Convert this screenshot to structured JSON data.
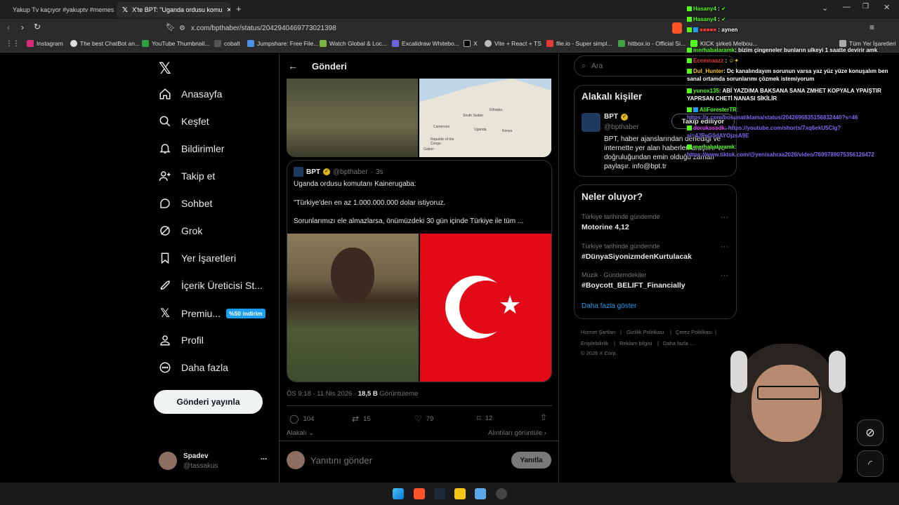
{
  "browser": {
    "tabs": [
      {
        "title": "Yakup Tv kaçıyor #yakuptv #memes",
        "active": false
      },
      {
        "title": "X'te BPT: \"Uganda ordusu komu",
        "active": true
      }
    ],
    "url": "x.com/bpthaber/status/2042940469773021398",
    "bookmarks": [
      "Instagram",
      "The best ChatBot an...",
      "YouTube Thumbnail...",
      "cobalt",
      "Jumpshare: Free File...",
      "Watch Global & Loc...",
      "Excalidraw Whitebo...",
      "X",
      "Vite + React + TS",
      "file.io - Super simpl...",
      "hitbox.io - Official Si...",
      "KICK şirketi Melbou...",
      "Tüm Yer İşaretleri"
    ]
  },
  "sidebar": {
    "items": [
      {
        "label": "Anasayfa",
        "icon": "home-icon"
      },
      {
        "label": "Keşfet",
        "icon": "search-icon"
      },
      {
        "label": "Bildirimler",
        "icon": "bell-icon"
      },
      {
        "label": "Takip et",
        "icon": "follow-icon"
      },
      {
        "label": "Sohbet",
        "icon": "chat-icon"
      },
      {
        "label": "Grok",
        "icon": "grok-icon"
      },
      {
        "label": "Yer İşaretleri",
        "icon": "bookmark-icon"
      },
      {
        "label": "İçerik Üreticisi St...",
        "icon": "rocket-icon"
      },
      {
        "label": "Premiu...",
        "icon": "x-icon"
      },
      {
        "label": "Profil",
        "icon": "profile-icon"
      },
      {
        "label": "Daha fazla",
        "icon": "more-icon"
      }
    ],
    "premium_badge": "%50 indirim",
    "post_button": "Gönderi yayınla",
    "account": {
      "name": "Spadev",
      "handle": "@tassakus",
      "more": "..."
    }
  },
  "post": {
    "header": "Gönderi",
    "map_labels": [
      "Cameroon",
      "South Sudan",
      "Ethiopia",
      "Republic of the Congo",
      "Uganda",
      "Kenya",
      "Gabon"
    ],
    "quoted": {
      "name": "BPT",
      "handle": "@bpthaber",
      "time": "3s",
      "line1": "Uganda ordusu komutanı Kainerugaba:",
      "line2": "\"Türkiye'den en az 1.000.000.000 dolar istiyoruz.",
      "line3": "Sorunlarımızı ele almazlarsa, önümüzdeki 30 gün içinde Türkiye ile tüm ..."
    },
    "meta_time": "ÖS 9:18 · 11 Nis 2026 · ",
    "views_count": "18,5 B",
    "views_label": "Görüntüleme",
    "stats": {
      "replies": "104",
      "reposts": "15",
      "likes": "79",
      "bookmarks": "12"
    },
    "related_left": "Alakalı",
    "related_right": "Alıntıları görüntüle",
    "reply_placeholder": "Yanıtını gönder",
    "reply_button": "Yanıtla"
  },
  "right": {
    "search_placeholder": "Ara",
    "related_title": "Alakalı kişiler",
    "person": {
      "name": "BPT",
      "handle": "@bpthaber",
      "follow": "Takip ediliyor",
      "bio": "BPT, haber ajanslarından derlediği ve internette yer alan haberleri araştırır ve doğruluğundan emin olduğu zaman paylaşır. info@bpt.tr"
    },
    "trends_title": "Neler oluyor?",
    "trends": [
      {
        "category": "Türkiye tarihinde gündemde",
        "name": "Motorine 4,12"
      },
      {
        "category": "Türkiye tarihinde gündemde",
        "name": "#DünyaSiyonizmdenKurtulacak"
      },
      {
        "category": "Müzik · Gündemdekiler",
        "name": "#Boycott_BELIFT_Financially"
      }
    ],
    "show_more": "Daha fazla göster",
    "footer": [
      "Hizmet Şartları",
      "|",
      "Gizlilik Politikası",
      "|",
      "Çerez Politikası",
      "|",
      "Erişilebilirlik",
      "|",
      "Reklam bilgisi",
      "|",
      "Daha fazla ...",
      "© 2026 X Corp."
    ]
  },
  "chat": [
    {
      "user": "Hasany4",
      "text": ""
    },
    {
      "user": "Hasany4",
      "text": ""
    },
    {
      "user": "",
      "text": "aynen"
    },
    {
      "user": "merhabalaramk",
      "text": ": bizim çingeneler bunların ulkeyi 1 saatte devirir amk"
    },
    {
      "user": "Ecemnaazz",
      "text": ""
    },
    {
      "user": "Dul_Hunter",
      "text": ": Dc kanalındayım sorunun varsa yaz yüz yüze konuşalım ben sanal ortamda sorunlarımı çözmek istemiyorum"
    },
    {
      "user": "yunox135",
      "text": ": ABİ YAZDIMA BAKSANA SANA ZMHET KOPYALA YPAIŞTIR YAPRSAN CHETİ NANASI SİKİLİR"
    },
    {
      "user": "AliForesterTR",
      "text": ": https://x.com/bosunatiklama/status/2042696835156832440?s=46"
    },
    {
      "user": "doruksssdk",
      "text": ": https://youtube.com/shorts/7xq6ekU5CIg?si=4JPeG0dAYOjzsA9E"
    },
    {
      "user": "merhabalaramk",
      "text": ": https://www.tiktok.com/@yenisahraa2026/video/7609789075356126472"
    }
  ],
  "colors": {
    "accent": "#1d9bf0",
    "bg": "#000000",
    "border": "#2f3336",
    "muted": "#71767b",
    "chat_name": "#53fc18",
    "chat_text": "#ffffff"
  }
}
